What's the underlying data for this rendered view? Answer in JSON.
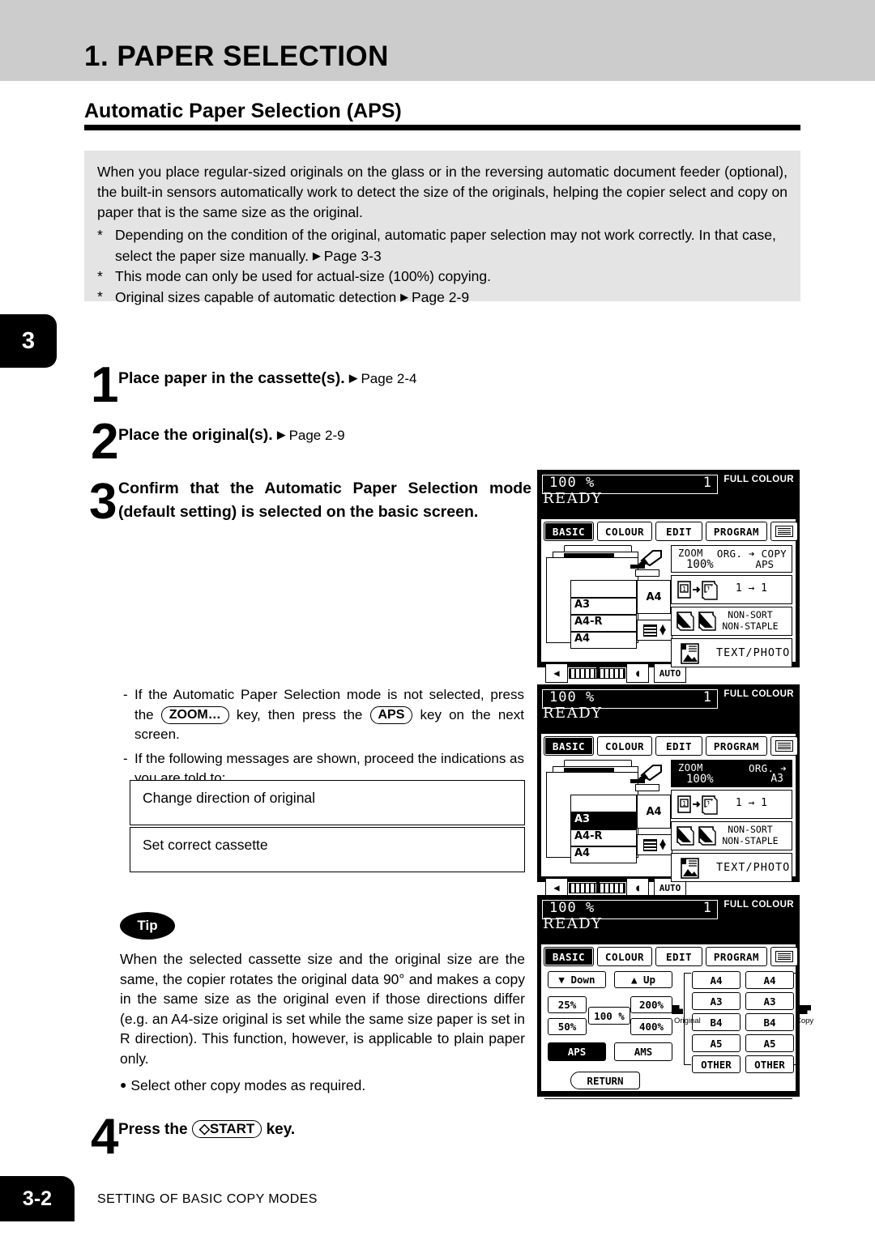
{
  "header": {
    "chapter_title": "1. PAPER SELECTION",
    "section_title": "Automatic Paper Selection (APS)",
    "index_tab": "3"
  },
  "intro": {
    "paragraph": "When you place regular-sized originals on the glass or in the reversing automatic document feeder (optional), the built-in sensors automatically work to detect the size of the originals, helping the copier select and copy on paper that is the same size as the original.",
    "notes": [
      {
        "marker": "*",
        "text": "Depending on the condition of the original, automatic paper selection may not work correctly. In that case, select the paper size manually.",
        "arrow": "▶",
        "ref": "Page 3-3"
      },
      {
        "marker": "*",
        "text": "This mode can only be used for actual-size (100%) copying.",
        "arrow": "",
        "ref": ""
      },
      {
        "marker": "*",
        "text": "Original sizes capable of automatic detection",
        "arrow": "▶",
        "ref": "Page 2-9"
      }
    ]
  },
  "steps": [
    {
      "num": "1",
      "text": "Place paper in the cassette(s).",
      "arrow": "▶",
      "ref": "Page 2-4"
    },
    {
      "num": "2",
      "text": "Place the original(s).",
      "arrow": "▶",
      "ref": "Page 2-9"
    },
    {
      "num": "3",
      "text": "Confirm that the Automatic Paper Selection mode (default setting) is selected on the basic screen.",
      "arrow": "",
      "ref": ""
    },
    {
      "num": "4",
      "text_pre": "Press the",
      "key": "START",
      "key_icon": "◇",
      "text_post": "key."
    }
  ],
  "notes_mid": {
    "note1_pre": "If the Automatic Paper Selection mode is not selected, press the",
    "note1_key1": "ZOOM…",
    "note1_mid": "key, then press the",
    "note1_key2": "APS",
    "note1_post": "key on the next screen.",
    "note2": "If the following messages are shown, proceed the indications as you are told to:",
    "message1": "Change direction of original",
    "message2": "Set correct cassette",
    "dash": "-"
  },
  "tip": {
    "badge": "Tip",
    "text": "When the selected cassette size and the original size are the same, the copier rotates the original data 90° and makes a copy in the same size as the original even if those directions differ (e.g. an A4-size original is set while the same size paper is set in R direction).  This function, however, is applicable to plain paper only.",
    "bullet": "Select other copy modes as required.",
    "bullet_dot": "●"
  },
  "footer": {
    "page": "3-2",
    "running_head": "SETTING OF BASIC COPY MODES"
  },
  "lcd_common": {
    "zoom_pct": "100  %",
    "copy_count": "1",
    "colour_mode": "FULL COLOUR",
    "status": "READY",
    "tabs": [
      {
        "label": "BASIC",
        "selected": true
      },
      {
        "label": "COLOUR",
        "selected": false
      },
      {
        "label": "EDIT",
        "selected": false
      },
      {
        "label": "PROGRAM",
        "selected": false
      },
      {
        "label": "",
        "selected": false,
        "icon": "screen-settings-icon"
      }
    ]
  },
  "lcd_panel1": {
    "caption": "basic-screen-aps-selected",
    "cassettes": [
      {
        "label": "",
        "selected": false
      },
      {
        "label": "A3",
        "selected": false
      },
      {
        "label": "A4-R",
        "selected": false
      },
      {
        "label": "A4",
        "selected": false
      }
    ],
    "bypass_label": "A4",
    "density_auto": "AUTO",
    "zoom_label": "ZOOM",
    "zoom_value": "100%",
    "org_copy_label": "ORG. ➔ COPY",
    "paper_mode": "APS",
    "paper_mode_inverted": false,
    "duplex": "1 → 1",
    "finisher": "NON-SORT\nNON-STAPLE",
    "finisher_line1": "NON-SORT",
    "finisher_line2": "NON-STAPLE",
    "original_mode": "TEXT/PHOTO"
  },
  "lcd_panel2": {
    "caption": "basic-screen-a3-selected",
    "cassettes": [
      {
        "label": "",
        "selected": false
      },
      {
        "label": "A3",
        "selected": true
      },
      {
        "label": "A4-R",
        "selected": false
      },
      {
        "label": "A4",
        "selected": false
      }
    ],
    "bypass_label": "A4",
    "density_auto": "AUTO",
    "zoom_label": "ZOOM",
    "zoom_value": "100%",
    "org_copy_label": "ORG. ➔",
    "paper_mode": "A3",
    "paper_mode_inverted": true,
    "duplex": "1 → 1",
    "finisher_line1": "NON-SORT",
    "finisher_line2": "NON-STAPLE",
    "original_mode": "TEXT/PHOTO"
  },
  "lcd_panel3": {
    "caption": "zoom-screen-aps-button",
    "down_label": "Down",
    "up_label": "Up",
    "down_arrow": "▼",
    "up_arrow": "▲",
    "ratios": [
      "25%",
      "50%",
      "100 %",
      "200%",
      "400%"
    ],
    "ratio_25": "25%",
    "ratio_50": "50%",
    "ratio_100": "100 %",
    "ratio_200": "200%",
    "ratio_400": "400%",
    "aps_label": "APS",
    "aps_selected": true,
    "ams_label": "AMS",
    "return_label": "RETURN",
    "original_group_label": "Original",
    "copy_group_label": "Copy",
    "original_sizes": [
      "A4",
      "A3",
      "B4",
      "A5",
      "OTHER"
    ],
    "copy_sizes": [
      "A4",
      "A3",
      "B4",
      "A5",
      "OTHER"
    ]
  }
}
